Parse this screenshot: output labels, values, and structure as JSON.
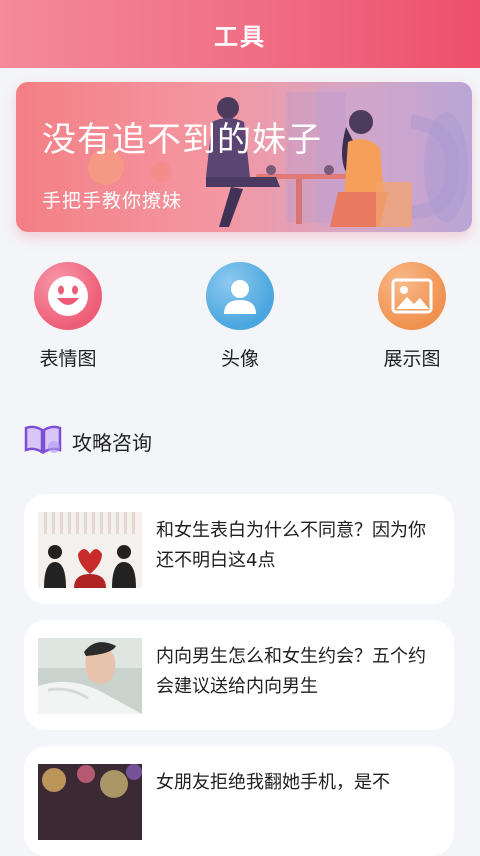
{
  "header": {
    "title": "工具"
  },
  "banner": {
    "headline": "没有追不到的妹子",
    "subline": "手把手教你撩妹"
  },
  "tools": [
    {
      "label": "表情图",
      "icon": "smiley-icon",
      "color": "#ee5d77"
    },
    {
      "label": "头像",
      "icon": "person-icon",
      "color": "#4aa6de"
    },
    {
      "label": "展示图",
      "icon": "image-icon",
      "color": "#f0914e"
    }
  ],
  "section": {
    "title": "攻略咨询",
    "icon": "book-icon"
  },
  "articles": [
    {
      "title": "和女生表白为什么不同意？因为你还不明白这4点"
    },
    {
      "title": "内向男生怎么和女生约会？五个约会建议送给内向男生"
    },
    {
      "title": "女朋友拒绝我翻她手机，是不"
    }
  ]
}
